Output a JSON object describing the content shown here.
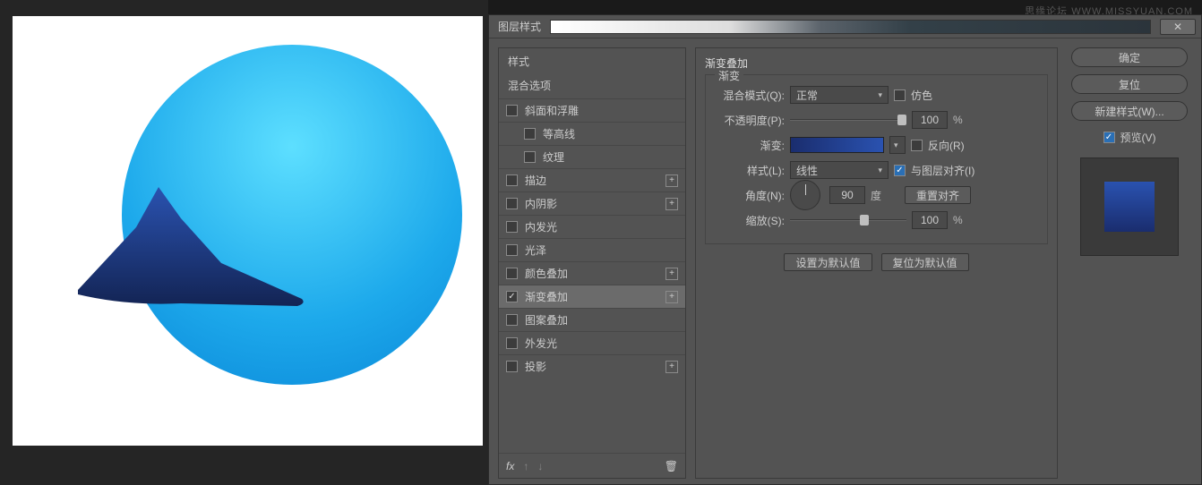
{
  "watermark": "思缘论坛  WWW.MISSYUAN.COM",
  "dialog": {
    "title": "图层样式",
    "styles_header": "样式",
    "blend_options": "混合选项",
    "rows": [
      {
        "label": "斜面和浮雕",
        "checked": false,
        "plus": false,
        "indent": false
      },
      {
        "label": "等高线",
        "checked": false,
        "plus": false,
        "indent": true
      },
      {
        "label": "纹理",
        "checked": false,
        "plus": false,
        "indent": true
      },
      {
        "label": "描边",
        "checked": false,
        "plus": true,
        "indent": false
      },
      {
        "label": "内阴影",
        "checked": false,
        "plus": true,
        "indent": false
      },
      {
        "label": "内发光",
        "checked": false,
        "plus": false,
        "indent": false
      },
      {
        "label": "光泽",
        "checked": false,
        "plus": false,
        "indent": false
      },
      {
        "label": "颜色叠加",
        "checked": false,
        "plus": true,
        "indent": false
      },
      {
        "label": "渐变叠加",
        "checked": true,
        "plus": true,
        "indent": false,
        "selected": true
      },
      {
        "label": "图案叠加",
        "checked": false,
        "plus": false,
        "indent": false
      },
      {
        "label": "外发光",
        "checked": false,
        "plus": false,
        "indent": false
      },
      {
        "label": "投影",
        "checked": false,
        "plus": true,
        "indent": false
      }
    ],
    "fx": "fx"
  },
  "panel": {
    "group_title": "渐变叠加",
    "legend": "渐变",
    "blend_mode_label": "混合模式(Q):",
    "blend_mode_value": "正常",
    "dither_label": "仿色",
    "opacity_label": "不透明度(P):",
    "opacity_value": "100",
    "percent": "%",
    "gradient_label": "渐变:",
    "reverse_label": "反向(R)",
    "style_label": "样式(L):",
    "style_value": "线性",
    "align_label": "与图层对齐(I)",
    "angle_label": "角度(N):",
    "angle_value": "90",
    "degree": "度",
    "reset_align": "重置对齐",
    "scale_label": "缩放(S):",
    "scale_value": "100",
    "set_default": "设置为默认值",
    "reset_default": "复位为默认值"
  },
  "actions": {
    "ok": "确定",
    "reset": "复位",
    "new_style": "新建样式(W)...",
    "preview": "预览(V)"
  }
}
